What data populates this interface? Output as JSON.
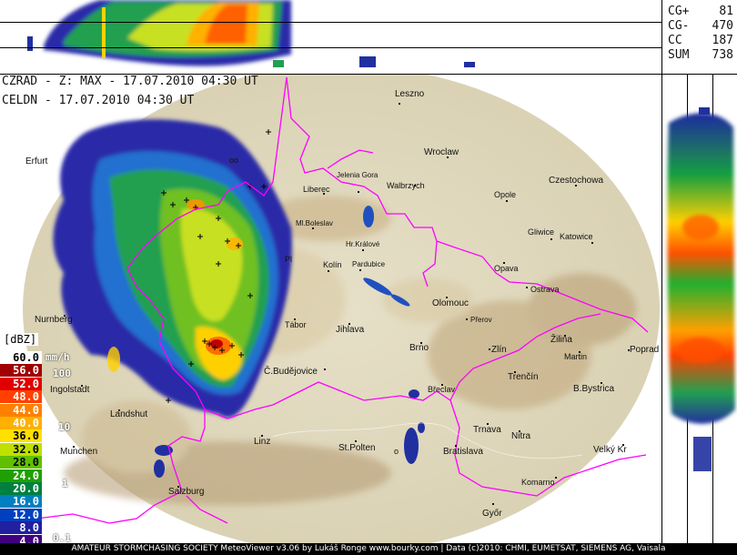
{
  "header": {
    "radar_line": "CZRAD - Z: MAX - 17.07.2010 04:30 UT",
    "lightning_line": "CELDN - 17.07.2010 04:30 UT"
  },
  "stats": [
    {
      "label": "CG+",
      "value": "81"
    },
    {
      "label": "CG-",
      "value": "470"
    },
    {
      "label": "CC",
      "value": "187"
    },
    {
      "label": "SUM",
      "value": "738"
    }
  ],
  "legend": {
    "title": "[dBZ]",
    "unit": "mm/h",
    "levels": [
      {
        "dbz": "60.0",
        "color": "#ffffff",
        "text": "#000000"
      },
      {
        "dbz": "56.0",
        "color": "#a00000",
        "text": "#ffffff"
      },
      {
        "dbz": "52.0",
        "color": "#e00000",
        "text": "#ffffff"
      },
      {
        "dbz": "48.0",
        "color": "#ff4000",
        "text": "#ffffff"
      },
      {
        "dbz": "44.0",
        "color": "#ff8000",
        "text": "#ffffff"
      },
      {
        "dbz": "40.0",
        "color": "#ffb000",
        "text": "#ffffff"
      },
      {
        "dbz": "36.0",
        "color": "#ffe000",
        "text": "#000000"
      },
      {
        "dbz": "32.0",
        "color": "#c0e000",
        "text": "#000000"
      },
      {
        "dbz": "28.0",
        "color": "#60c000",
        "text": "#000000"
      },
      {
        "dbz": "24.0",
        "color": "#20a000",
        "text": "#ffffff"
      },
      {
        "dbz": "20.0",
        "color": "#008040",
        "text": "#ffffff"
      },
      {
        "dbz": "16.0",
        "color": "#0080c0",
        "text": "#ffffff"
      },
      {
        "dbz": "12.0",
        "color": "#0040c0",
        "text": "#ffffff"
      },
      {
        "dbz": "8.0",
        "color": "#2020a0",
        "text": "#ffffff"
      },
      {
        "dbz": "4.0",
        "color": "#400080",
        "text": "#ffffff"
      }
    ],
    "rain_rates": [
      "100",
      "10",
      "1",
      "0.1"
    ]
  },
  "cities": {
    "leszno": "Leszno",
    "wroclaw": "Wroclaw",
    "jelenia_gora": "Jelenia Gora",
    "walbrzych": "Walbrzych",
    "liberec": "Liberec",
    "czestochowa": "Czestochowa",
    "opole": "Opole",
    "gliwice": "Gliwice",
    "katowice": "Katowice",
    "ml_boleslav": "Ml.Boleslav",
    "hr_kralove": "Hr.Králové",
    "pardubice": "Pardubice",
    "kolin": "Kolín",
    "opava": "Opava",
    "ostrava": "Ostrava",
    "olomouc": "Olomouc",
    "prerov": "Přerov",
    "jihlava": "Jihlava",
    "tabor": "Tábor",
    "brno": "Brno",
    "zlin": "Zlín",
    "zilina": "Žilina",
    "martin": "Martin",
    "poprad": "Poprad",
    "nurnberg": "Nurnberg",
    "ingolstadt": "Ingolstadt",
    "c_budejovice": "Č.Budějovice",
    "breclav": "Břeclav",
    "trencin": "Trenčín",
    "b_bystrica": "B.Bystrica",
    "landshut": "Landshut",
    "linz": "Linz",
    "trnava": "Trnava",
    "nitra": "Nitra",
    "munchen": "Munchen",
    "st_polten": "St.Polten",
    "bratislava": "Bratislava",
    "velky_kr": "Velký Kr",
    "komarno": "Komarno",
    "salzburg": "Salzburg",
    "gyor": "Győr",
    "erfurt": "Erfurt",
    "pl_partial": "Pl",
    "oo_partial": "oo",
    "oo_label": "o"
  },
  "footer": {
    "text": "AMATEUR STORMCHASING SOCIETY MeteoViewer v3.06 by Lukáš Ronge www.bourky.com | Data (c)2010: CHMI, EUMETSAT, SIEMENS AG, Vaisala"
  },
  "colors": {
    "border": "#ff00ff",
    "terrain_low": "#ece8d8",
    "terrain_high": "#c8a878"
  }
}
